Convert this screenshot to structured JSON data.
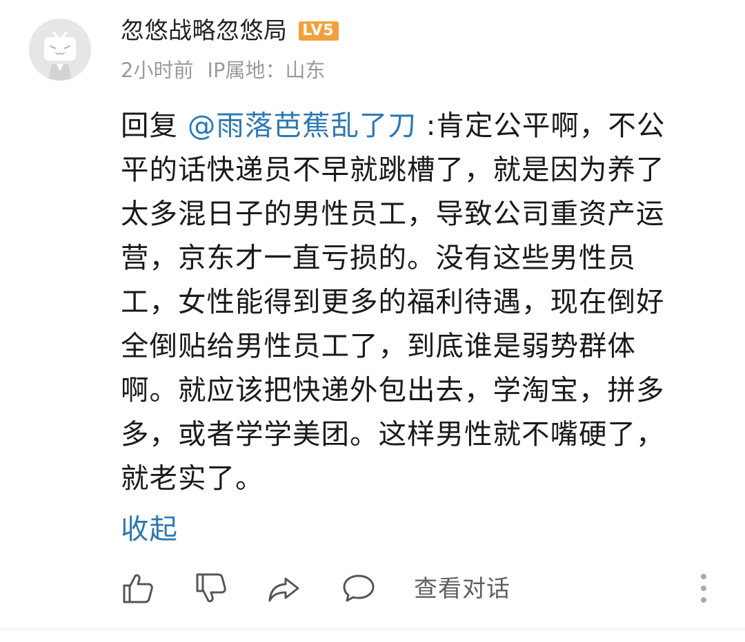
{
  "comment": {
    "username": "忽悠战略忽悠局",
    "level_badge": "LV5",
    "time": "2小时前",
    "ip_location": "IP属地：山东",
    "reply_prefix": "回复 ",
    "mention": "@雨落芭蕉乱了刀",
    "lines": [
      " :肯定公平啊，不公",
      "平的话快递员不早就跳槽了，就是因为养了",
      "太多混日子的男性员工，导致公司重资产运",
      "营，京东才一直亏损的。没有这些男性员",
      "工，女性能得到更多的福利待遇，现在倒好",
      "全倒贴给男性员工了，到底谁是弱势群体",
      "啊。就应该把快递外包出去，学淘宝，拼多",
      "多，或者学学美团。这样男性就不嘴硬了，",
      "就老实了。"
    ],
    "collapse_label": "收起"
  },
  "actions": {
    "like_icon": "thumbs-up-icon",
    "dislike_icon": "thumbs-down-icon",
    "share_icon": "share-icon",
    "reply_icon": "comment-bubble-icon",
    "view_conversation_label": "查看对话",
    "more_icon": "more-vertical-icon"
  },
  "colors": {
    "link": "#2b78b4",
    "level_badge": "#f2a03c",
    "meta_text": "#9a9a9a"
  }
}
